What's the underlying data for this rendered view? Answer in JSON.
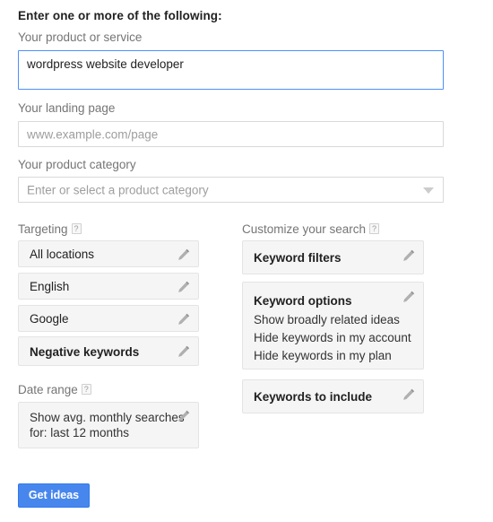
{
  "form": {
    "heading": "Enter one or more of the following:",
    "product_service": {
      "label": "Your product or service",
      "value": "wordpress website developer"
    },
    "landing_page": {
      "label": "Your landing page",
      "placeholder": "www.example.com/page",
      "value": ""
    },
    "product_category": {
      "label": "Your product category",
      "placeholder": "Enter or select a product category",
      "value": "",
      "caret_icon": "chevron-down-icon"
    }
  },
  "targeting": {
    "label": "Targeting",
    "help_icon": "help-icon",
    "help_label": "?",
    "items": [
      {
        "title": "All locations",
        "bold": false,
        "edit_icon": "pencil-icon"
      },
      {
        "title": "English",
        "bold": false,
        "edit_icon": "pencil-icon"
      },
      {
        "title": "Google",
        "bold": false,
        "edit_icon": "pencil-icon"
      },
      {
        "title": "Negative keywords",
        "bold": true,
        "edit_icon": "pencil-icon"
      }
    ]
  },
  "date_range": {
    "label": "Date range",
    "help_label": "?",
    "line1": "Show avg. monthly searches",
    "line2": "for: last 12 months",
    "edit_icon": "pencil-icon"
  },
  "customize": {
    "label": "Customize your search",
    "help_label": "?",
    "keyword_filters": {
      "title": "Keyword filters",
      "edit_icon": "pencil-icon"
    },
    "keyword_options": {
      "title": "Keyword options",
      "option1": "Show broadly related ideas",
      "option2": "Hide keywords in my account",
      "option3": "Hide keywords in my plan",
      "edit_icon": "pencil-icon"
    },
    "keywords_to_include": {
      "title": "Keywords to include",
      "edit_icon": "pencil-icon"
    }
  },
  "actions": {
    "get_ideas_label": "Get ideas"
  },
  "colors": {
    "accent_blue": "#4787ed",
    "focus_border": "#4d90fe",
    "card_bg": "#f5f5f5",
    "label_grey": "#757575"
  }
}
